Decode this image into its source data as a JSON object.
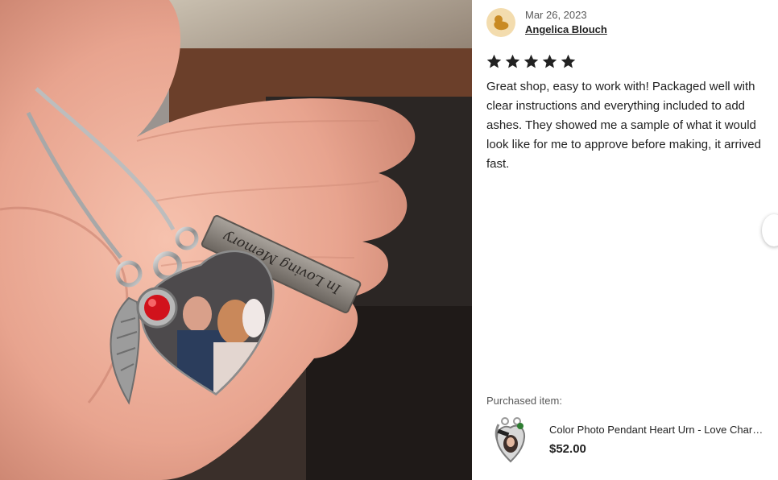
{
  "review": {
    "date": "Mar 26, 2023",
    "reviewer_name": "Angelica Blouch",
    "rating": 5,
    "rating_max": 5,
    "text": "Great shop, easy to work with! Packaged well with clear instructions and everything included to add ashes. They showed me a sample of what it would look like for me to approve before making, it arrived fast."
  },
  "photo": {
    "engraving": "In Loving Memory"
  },
  "purchased": {
    "label": "Purchased item:",
    "title": "Color Photo Pendant Heart Urn - Love Charm Cremation Jewelry",
    "price": "$52.00"
  },
  "icons": {
    "avatar": "avatar-icon",
    "star": "star-icon",
    "next": "chevron-right-icon"
  },
  "colors": {
    "star": "#222222",
    "avatar_bg": "#f3dcae",
    "avatar_fg": "#c98a23"
  }
}
